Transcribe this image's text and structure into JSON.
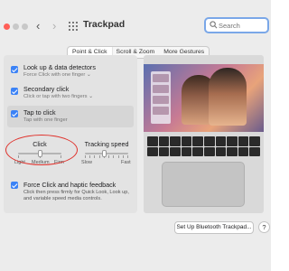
{
  "window": {
    "title": "Trackpad",
    "back_icon": "chevron-left-icon",
    "forward_icon": "chevron-right-icon",
    "grid_icon": "show-all-grid-icon"
  },
  "search": {
    "placeholder": "Search",
    "value": ""
  },
  "tabs": [
    {
      "label": "Point & Click",
      "active": true
    },
    {
      "label": "Scroll & Zoom",
      "active": false
    },
    {
      "label": "More Gestures",
      "active": false
    }
  ],
  "options": [
    {
      "title": "Look up & data detectors",
      "subtitle": "Force Click with one finger ⌄",
      "checked": true
    },
    {
      "title": "Secondary click",
      "subtitle": "Click or tap with two fingers ⌄",
      "checked": true
    },
    {
      "title": "Tap to click",
      "subtitle": "Tap with one finger",
      "checked": true
    }
  ],
  "click_slider": {
    "label": "Click",
    "ticks": [
      "Light",
      "Medium",
      "Firm"
    ],
    "level": 1
  },
  "tracking_slider": {
    "label": "Tracking speed",
    "min_label": "Slow",
    "max_label": "Fast",
    "level": 0.45
  },
  "force_click": {
    "title": "Force Click and haptic feedback",
    "description": "Click then press firmly for Quick Look, Look up, and variable speed media controls.",
    "checked": true
  },
  "footer": {
    "bluetooth_button": "Set Up Bluetooth Trackpad...",
    "help": "?"
  },
  "colors": {
    "accent": "#3b82f6",
    "annotation": "#e0302a",
    "close": "#ff5f57"
  }
}
